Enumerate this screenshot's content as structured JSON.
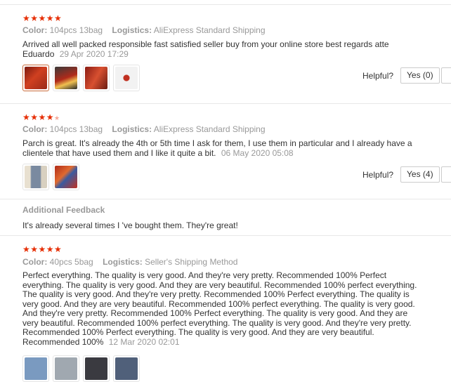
{
  "colors": {
    "star": "#e62e04",
    "muted": "#999999",
    "text": "#333333"
  },
  "labels": {
    "color": "Color:",
    "logistics": "Logistics:",
    "helpful": "Helpful?"
  },
  "reviews": [
    {
      "stars": 5,
      "color": "104pcs 13bag",
      "logistics": "AliExpress Standard Shipping",
      "text": "Arrived all well packed responsible fast satisfied seller buy from your online store best regards atte Eduardo",
      "date": "29 Apr 2020 17:29",
      "yes": "Yes (0)",
      "photos": [
        "photo-1",
        "photo-2",
        "photo-3",
        "photo-4"
      ]
    },
    {
      "stars": 4,
      "color": "104pcs 13bag",
      "logistics": "AliExpress Standard Shipping",
      "text": "Parch is great. It's already the 4th or 5th time I ask for them, I use them in particular and I already have a clientele that have used them and I like it quite a bit.",
      "date": "06 May 2020 05:08",
      "yes": "Yes (4)",
      "photos": [
        "photo-1",
        "photo-2"
      ],
      "additional_title": "Additional Feedback",
      "additional_text": "It's already several times I 've bought them. They're great!"
    },
    {
      "stars": 5,
      "color": "40pcs 5bag",
      "logistics": "Seller's Shipping Method",
      "text": "Perfect everything. The quality is very good. And they're very pretty. Recommended 100% Perfect everything. The quality is very good. And they are very beautiful. Recommended 100% perfect everything. The quality is very good. And they're very pretty. Recommended 100% Perfect everything. The quality is very good. And they are very beautiful. Recommended 100% perfect everything. The quality is very good. And they're very pretty. Recommended 100% Perfect everything. The quality is very good. And they are very beautiful. Recommended 100% perfect everything. The quality is very good. And they're very pretty. Recommended 100% Perfect everything. The quality is very good. And they are very beautiful. Recommended 100%",
      "date": "12 Mar 2020 02:01"
    }
  ]
}
